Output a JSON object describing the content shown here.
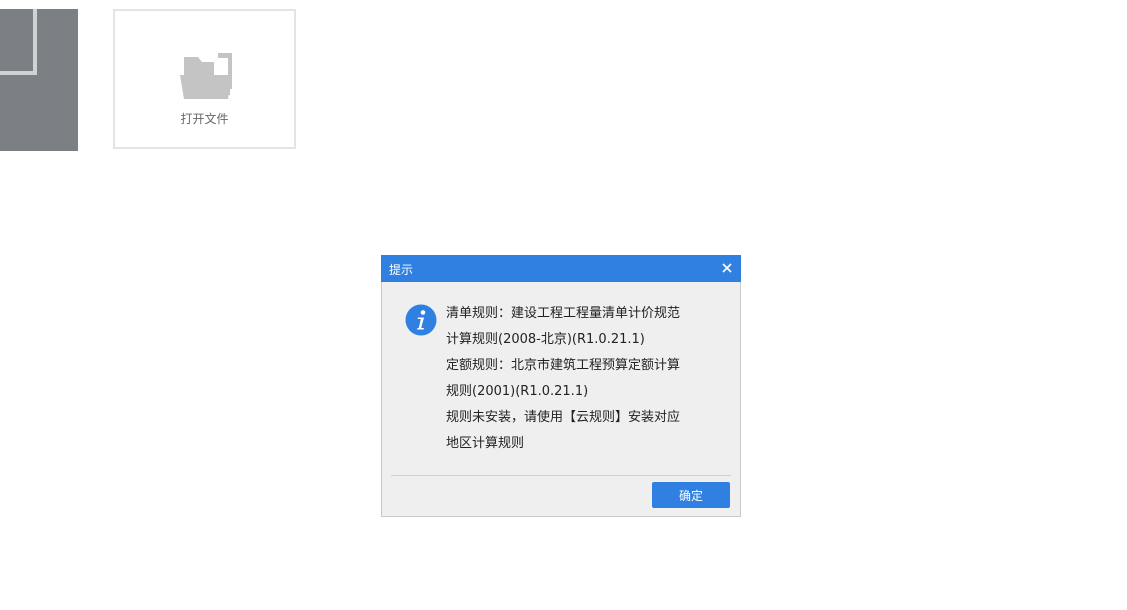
{
  "start_page": {
    "recent_thumbnail_icon": "document-thumbnail",
    "open_file": {
      "label": "打开文件",
      "icon": "folder-icon"
    }
  },
  "dialog": {
    "title": "提示",
    "close_icon": "close-icon",
    "info_icon": "info-icon",
    "message_lines": [
      "清单规则：建设工程工程量清单计价规范",
      "计算规则(2008-北京)(R1.0.21.1)",
      "定额规则：北京市建筑工程预算定额计算",
      "规则(2001)(R1.0.21.1)",
      "规则未安装，请使用【云规则】安装对应",
      "地区计算规则"
    ],
    "confirm_label": "确定"
  },
  "colors": {
    "accent": "#2f80e0",
    "dialog_background": "#efefef",
    "thumbnail_background": "#7c7f83",
    "folder_icon": "#c4c4c4"
  }
}
